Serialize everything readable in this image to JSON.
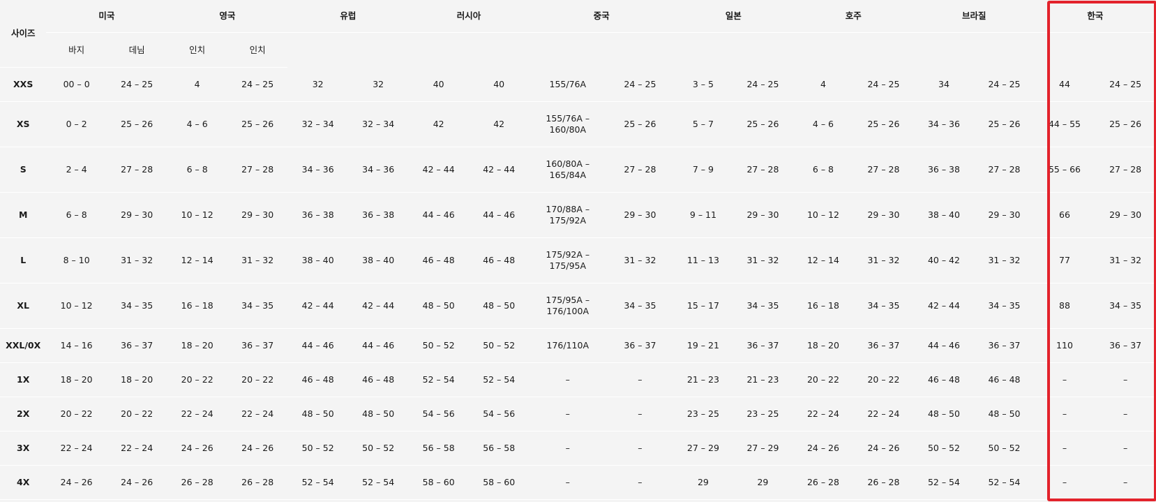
{
  "size_header": "사이즈",
  "countries": [
    "미국",
    "영국",
    "유럽",
    "러시아",
    "중국",
    "일본",
    "호주",
    "브라질",
    "한국"
  ],
  "subheaders": [
    "바지",
    "데님",
    "인치",
    "인치"
  ],
  "highlight_color": "#e3222b",
  "rows": [
    {
      "size": "XXS",
      "values": [
        "00 – 0",
        "24 – 25",
        "4",
        "24 – 25",
        "32",
        "32",
        "40",
        "40",
        "155/76A",
        "24 – 25",
        "3 – 5",
        "24 – 25",
        "4",
        "24 – 25",
        "34",
        "24 – 25",
        "44",
        "24 – 25"
      ]
    },
    {
      "size": "XS",
      "values": [
        "0 – 2",
        "25 – 26",
        "4 – 6",
        "25 – 26",
        "32 – 34",
        "32 – 34",
        "42",
        "42",
        "155/76A – 160/80A",
        "25 – 26",
        "5 – 7",
        "25 – 26",
        "4 – 6",
        "25 – 26",
        "34 – 36",
        "25 – 26",
        "44 – 55",
        "25 – 26"
      ]
    },
    {
      "size": "S",
      "values": [
        "2 – 4",
        "27 – 28",
        "6 – 8",
        "27 – 28",
        "34 – 36",
        "34 – 36",
        "42 – 44",
        "42 – 44",
        "160/80A – 165/84A",
        "27 – 28",
        "7 – 9",
        "27 – 28",
        "6 – 8",
        "27 – 28",
        "36 – 38",
        "27 – 28",
        "55 – 66",
        "27 – 28"
      ]
    },
    {
      "size": "M",
      "values": [
        "6 – 8",
        "29 – 30",
        "10 – 12",
        "29 – 30",
        "36 – 38",
        "36 – 38",
        "44 – 46",
        "44 – 46",
        "170/88A – 175/92A",
        "29 – 30",
        "9 – 11",
        "29 – 30",
        "10 – 12",
        "29 – 30",
        "38 – 40",
        "29 – 30",
        "66",
        "29 – 30"
      ]
    },
    {
      "size": "L",
      "values": [
        "8 – 10",
        "31 – 32",
        "12 – 14",
        "31 – 32",
        "38 – 40",
        "38 – 40",
        "46 – 48",
        "46 – 48",
        "175/92A – 175/95A",
        "31 – 32",
        "11 – 13",
        "31 – 32",
        "12 – 14",
        "31 – 32",
        "40 – 42",
        "31 – 32",
        "77",
        "31 – 32"
      ]
    },
    {
      "size": "XL",
      "values": [
        "10 – 12",
        "34 – 35",
        "16 – 18",
        "34 – 35",
        "42 – 44",
        "42 – 44",
        "48 – 50",
        "48 – 50",
        "175/95A – 176/100A",
        "34 – 35",
        "15 – 17",
        "34 – 35",
        "16 – 18",
        "34 – 35",
        "42 – 44",
        "34 – 35",
        "88",
        "34 – 35"
      ]
    },
    {
      "size": "XXL/0X",
      "values": [
        "14 – 16",
        "36 – 37",
        "18 – 20",
        "36 – 37",
        "44 – 46",
        "44 – 46",
        "50 – 52",
        "50 – 52",
        "176/110A",
        "36 – 37",
        "19 – 21",
        "36 – 37",
        "18 – 20",
        "36 – 37",
        "44 – 46",
        "36 – 37",
        "110",
        "36 – 37"
      ]
    },
    {
      "size": "1X",
      "values": [
        "18 – 20",
        "18 – 20",
        "20 – 22",
        "20 – 22",
        "46 – 48",
        "46 – 48",
        "52 – 54",
        "52 – 54",
        "–",
        "–",
        "21 – 23",
        "21 – 23",
        "20 – 22",
        "20 – 22",
        "46 – 48",
        "46 – 48",
        "–",
        "–"
      ]
    },
    {
      "size": "2X",
      "values": [
        "20 – 22",
        "20 – 22",
        "22 – 24",
        "22 – 24",
        "48 – 50",
        "48 – 50",
        "54 – 56",
        "54 – 56",
        "–",
        "–",
        "23 – 25",
        "23 – 25",
        "22 – 24",
        "22 – 24",
        "48 – 50",
        "48 – 50",
        "–",
        "–"
      ]
    },
    {
      "size": "3X",
      "values": [
        "22 – 24",
        "22 – 24",
        "24 – 26",
        "24 – 26",
        "50 – 52",
        "50 – 52",
        "56 – 58",
        "56 – 58",
        "–",
        "–",
        "27 – 29",
        "27 – 29",
        "24 – 26",
        "24 – 26",
        "50 – 52",
        "50 – 52",
        "–",
        "–"
      ]
    },
    {
      "size": "4X",
      "values": [
        "24 – 26",
        "24 – 26",
        "26 – 28",
        "26 – 28",
        "52 – 54",
        "52 – 54",
        "58 – 60",
        "58 – 60",
        "–",
        "–",
        "29",
        "29",
        "26 – 28",
        "26 – 28",
        "52 – 54",
        "52 – 54",
        "–",
        "–"
      ]
    }
  ]
}
